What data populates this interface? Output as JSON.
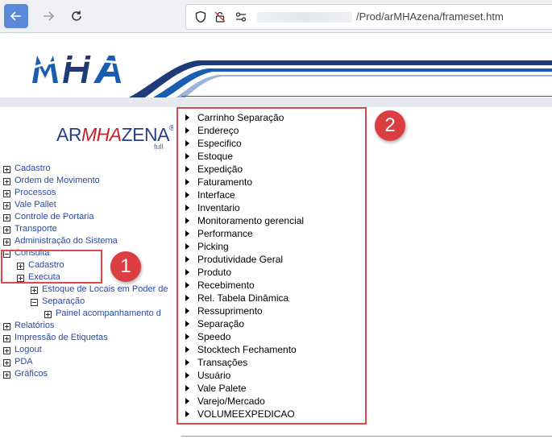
{
  "browser": {
    "url_suffix": "/Prod/arMHAzena/frameset.htm"
  },
  "header": {
    "logo_text": "MHA"
  },
  "left_frame": {
    "logo": {
      "part1": "AR",
      "part2": "MHA",
      "part3": "ZENA",
      "reg": "®",
      "sub": "full"
    },
    "tree": [
      {
        "label": "Cadastro",
        "level": 0,
        "expanded": false
      },
      {
        "label": "Ordem de Movimento",
        "level": 0,
        "expanded": false
      },
      {
        "label": "Processos",
        "level": 0,
        "expanded": false
      },
      {
        "label": "Vale Pallet",
        "level": 0,
        "expanded": false
      },
      {
        "label": "Controle de Portaria",
        "level": 0,
        "expanded": false
      },
      {
        "label": "Transporte",
        "level": 0,
        "expanded": false
      },
      {
        "label": "Administração do Sistema",
        "level": 0,
        "expanded": false
      },
      {
        "label": "Consulta",
        "level": 0,
        "expanded": true
      },
      {
        "label": "Cadastro",
        "level": 1,
        "expanded": false
      },
      {
        "label": "Executa",
        "level": 1,
        "expanded": false
      },
      {
        "label": "Estoque de Locais em Poder de",
        "level": 2,
        "expanded": false
      },
      {
        "label": "Separação",
        "level": 2,
        "expanded": true
      },
      {
        "label": "Painel acompanhamento d",
        "level": 3,
        "expanded": false
      },
      {
        "label": "Relatórios",
        "level": 0,
        "expanded": false
      },
      {
        "label": "Impressão de Etiquetas",
        "level": 0,
        "expanded": false
      },
      {
        "label": "Logout",
        "level": 0,
        "expanded": false
      },
      {
        "label": "PDA",
        "level": 0,
        "expanded": false
      },
      {
        "label": "Gráficos",
        "level": 0,
        "expanded": false
      }
    ]
  },
  "annotations": {
    "badge1": "1",
    "badge2": "2"
  },
  "menu": [
    "Carrinho Separação",
    "Endereço",
    "Especifico",
    "Estoque",
    "Expedição",
    "Faturamento",
    "Interface",
    "Inventario",
    "Monitoramento gerencial",
    "Performance",
    "Picking",
    "Produtividade Geral",
    "Produto",
    "Recebimento",
    "Rel. Tabela Dinâmica",
    "Ressuprimento",
    "Separação",
    "Speedo",
    "Stocktech Fechamento",
    "Transações",
    "Usuário",
    "Vale Palete",
    "Varejo/Mercado",
    "VOLUMEEXPEDICAO"
  ],
  "colors": {
    "accent_blue": "#2a4aa6",
    "highlight_red": "#e0474c",
    "logo_blue": "#1a5db0",
    "logo_navy": "#1f3a78"
  },
  "icons": {
    "back": "arrow-left-icon",
    "forward": "arrow-right-icon",
    "reload": "reload-icon",
    "shield": "shield-icon",
    "tracking": "tracking-protection-icon",
    "permissions": "permissions-icon"
  }
}
